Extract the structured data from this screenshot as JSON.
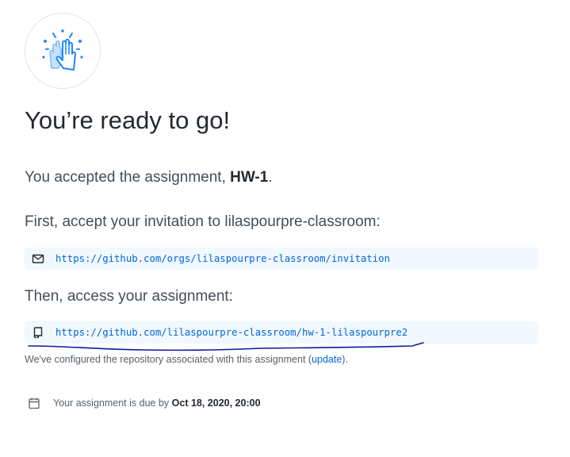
{
  "heading": "You’re ready to go!",
  "accepted": {
    "prefix": "You accepted the assignment, ",
    "assignment": "HW-1",
    "suffix": "."
  },
  "invitation": {
    "text": "First, accept your invitation to lilaspourpre-classroom:",
    "url": "https://github.com/orgs/lilaspourpre-classroom/invitation"
  },
  "repo": {
    "text": "Then, access your assignment:",
    "url": "https://github.com/lilaspourpre-classroom/hw-1-lilaspourpre2"
  },
  "configured": {
    "prefix": "We've configured the repository associated with this assignment (",
    "link": "update",
    "suffix": ")."
  },
  "due": {
    "prefix": "Your assignment is due by ",
    "date": "Oct 18, 2020, 20:00"
  },
  "colors": {
    "accent": "#0366d6",
    "url_bg": "#f1f8ff",
    "hand_blue": "#2188ff",
    "annotation": "#0b1a9c"
  },
  "icons": {
    "avatar": "high-five-hands-icon",
    "invitation": "mail-icon",
    "repo": "repo-icon",
    "due": "calendar-icon"
  }
}
